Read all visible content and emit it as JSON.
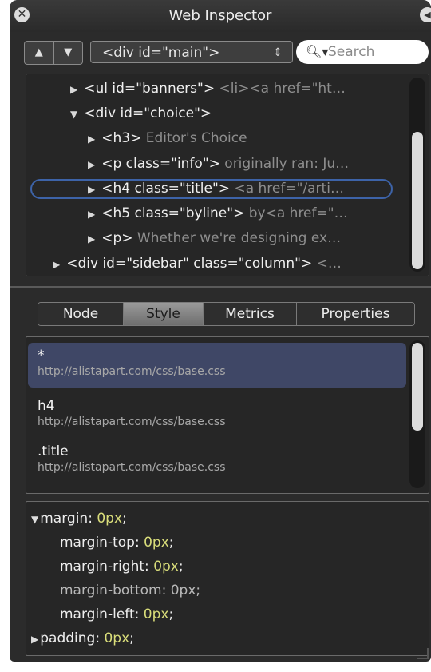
{
  "window": {
    "title": "Web Inspector"
  },
  "toolbar": {
    "up_glyph": "▲",
    "down_glyph": "▼",
    "node_select_value": "<div id=\"main\">",
    "search_placeholder": "Search"
  },
  "dom_tree": {
    "rows": [
      {
        "tag": "<ul id=\"banners\">",
        "preview": "<li><a href=\"ht…"
      },
      {
        "tag": "<div id=\"choice\">",
        "preview": ""
      },
      {
        "tag": "<h3>",
        "preview": "Editor's Choice"
      },
      {
        "tag": "<p class=\"info\">",
        "preview": "originally ran: Ju…"
      },
      {
        "tag": "<h4 class=\"title\">",
        "preview": "<a href=\"/arti…"
      },
      {
        "tag": "<h5 class=\"byline\">",
        "preview": "by<a href=\"…"
      },
      {
        "tag": "<p>",
        "preview": "Whether we're designing ex…"
      },
      {
        "tag": "<div id=\"sidebar\" class=\"column\">",
        "preview": "<…"
      }
    ],
    "selected_row": 4
  },
  "tabs": [
    "Node",
    "Style",
    "Metrics",
    "Properties"
  ],
  "active_tab": "Style",
  "style_rules": [
    {
      "selector": "*",
      "source": "http://alistapart.com/css/base.css"
    },
    {
      "selector": "h4",
      "source": "http://alistapart.com/css/base.css"
    },
    {
      "selector": ".title",
      "source": "http://alistapart.com/css/base.css"
    }
  ],
  "properties": [
    {
      "name": "margin",
      "value": "0px",
      "expanded": true,
      "struck": false
    },
    {
      "name": "margin-top",
      "value": "0px",
      "struck": false
    },
    {
      "name": "margin-right",
      "value": "0px",
      "struck": false
    },
    {
      "name": "margin-bottom",
      "value": "0px",
      "struck": true
    },
    {
      "name": "margin-left",
      "value": "0px",
      "struck": false
    },
    {
      "name": "padding",
      "value": "0px",
      "expanded": false,
      "struck": false
    }
  ],
  "colors": {
    "selection_outline": "#3d63a8",
    "selected_rule_bg": "#3f4766",
    "value_color": "#d9dd7a"
  }
}
